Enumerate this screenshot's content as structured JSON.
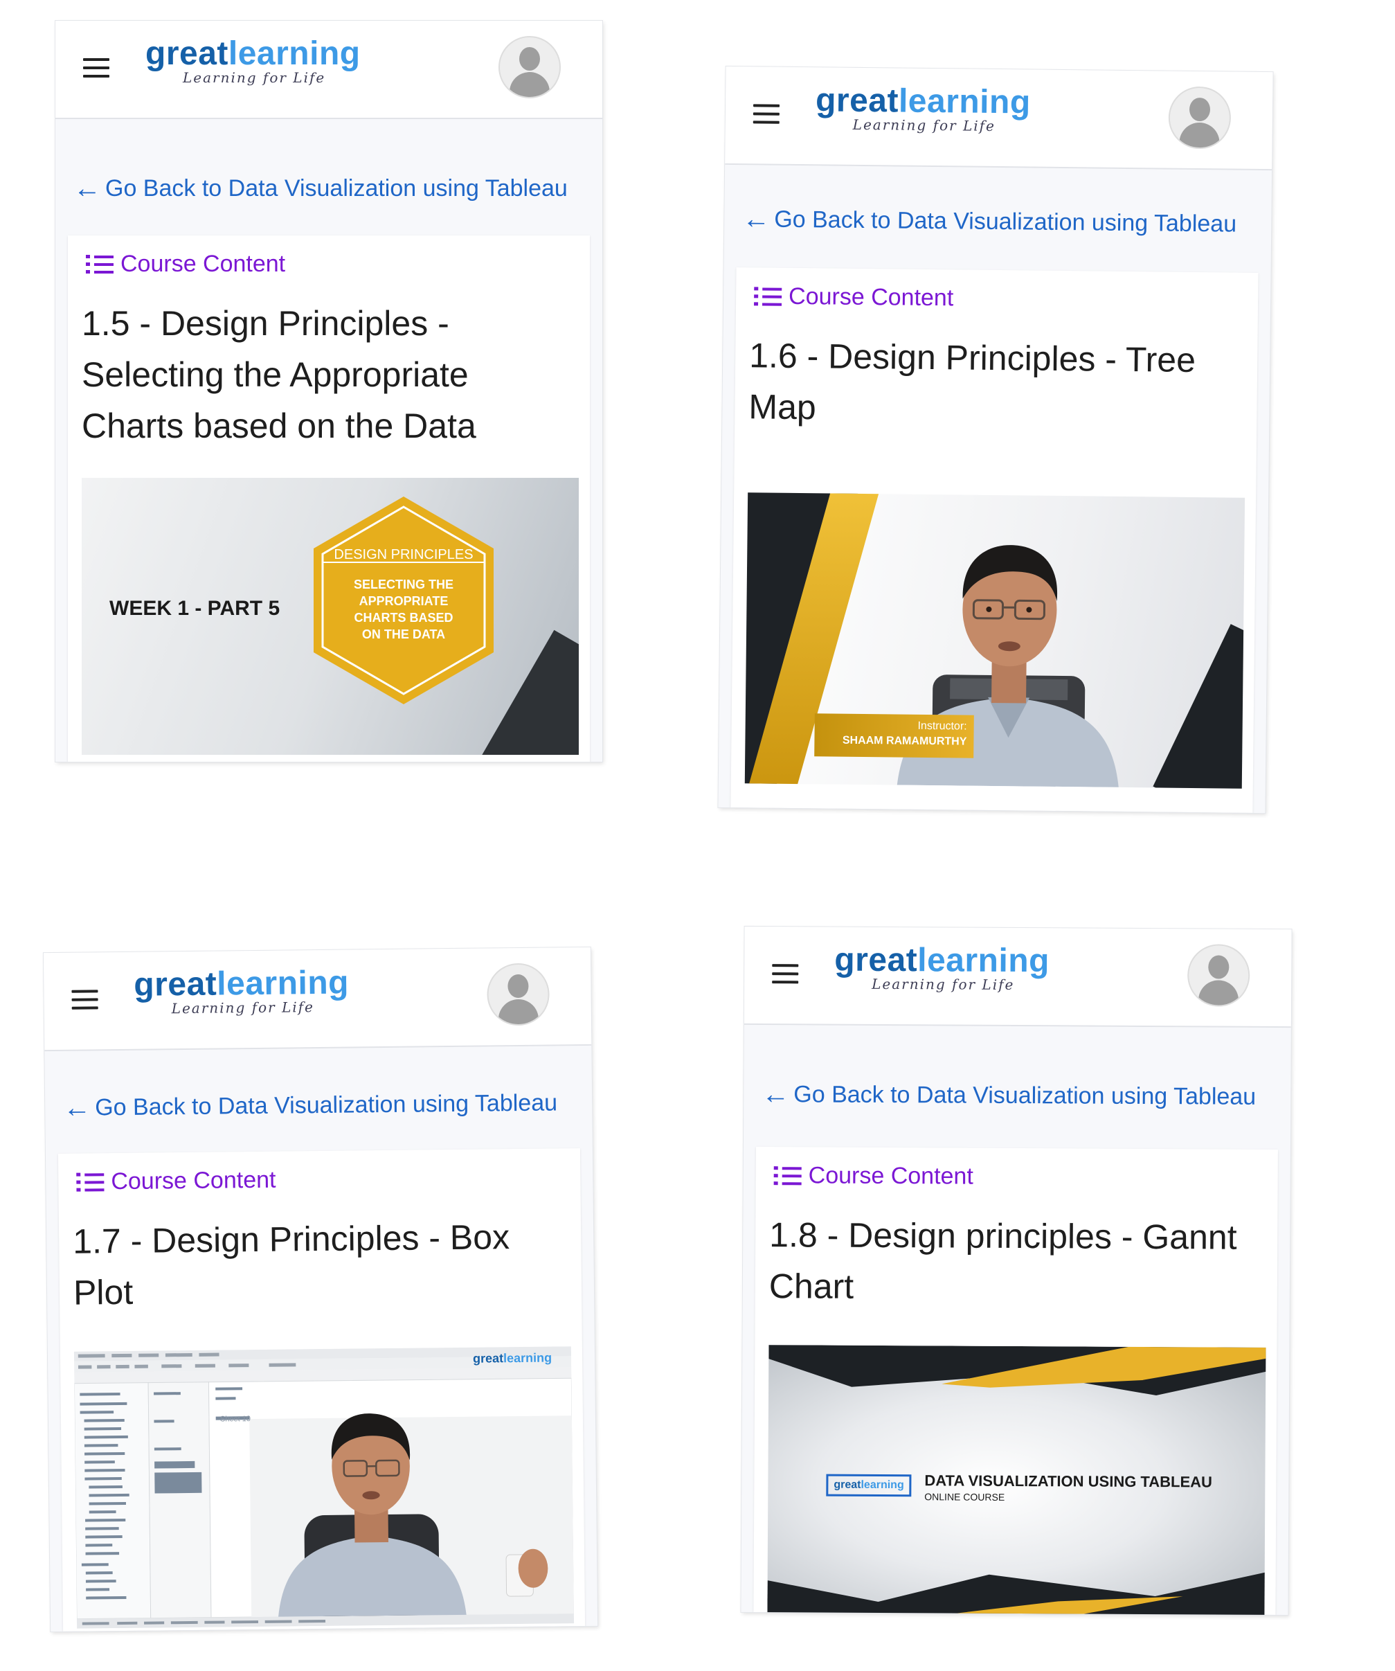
{
  "brand": {
    "logo_part1": "great",
    "logo_part2": "learning",
    "tagline": "Learning for Life"
  },
  "colors": {
    "link_blue": "#1f66c7",
    "course_content_purple": "#7b17d4",
    "logo_dark_blue": "#1560a8",
    "logo_light_blue": "#3d9ae6",
    "gold": "#e8b22a"
  },
  "panels": [
    {
      "back_link": "Go Back to Data Visualization using Tableau",
      "course_content_label": "Course Content",
      "lesson_title": "1.5 - Design Principles - Selecting the Appropriate Charts based on the Data",
      "video": {
        "week_label": "WEEK 1 - PART 5",
        "hex_heading": "DESIGN PRINCIPLES",
        "hex_line1": "SELECTING THE",
        "hex_line2": "APPROPRIATE",
        "hex_line3": "CHARTS BASED",
        "hex_line4": "ON THE DATA"
      }
    },
    {
      "back_link": "Go Back to Data Visualization using Tableau",
      "course_content_label": "Course Content",
      "lesson_title": "1.6 - Design Principles - Tree Map",
      "video": {
        "instructor_label": "Instructor:",
        "instructor_name": "SHAAM RAMAMURTHY"
      }
    },
    {
      "back_link": "Go Back to Data Visualization using Tableau",
      "course_content_label": "Course Content",
      "lesson_title": "1.7 - Design Principles - Box Plot",
      "video": {
        "logo_part1": "great",
        "logo_part2": "learning",
        "sheet_label": "Sheet 10"
      }
    },
    {
      "back_link": "Go Back to Data Visualization using Tableau",
      "course_content_label": "Course Content",
      "lesson_title": "1.8 - Design principles - Gannt Chart",
      "video": {
        "badge_part1": "great",
        "badge_part2": "learning",
        "title": "DATA VISUALIZATION USING TABLEAU",
        "subtitle": "ONLINE COURSE"
      }
    }
  ]
}
